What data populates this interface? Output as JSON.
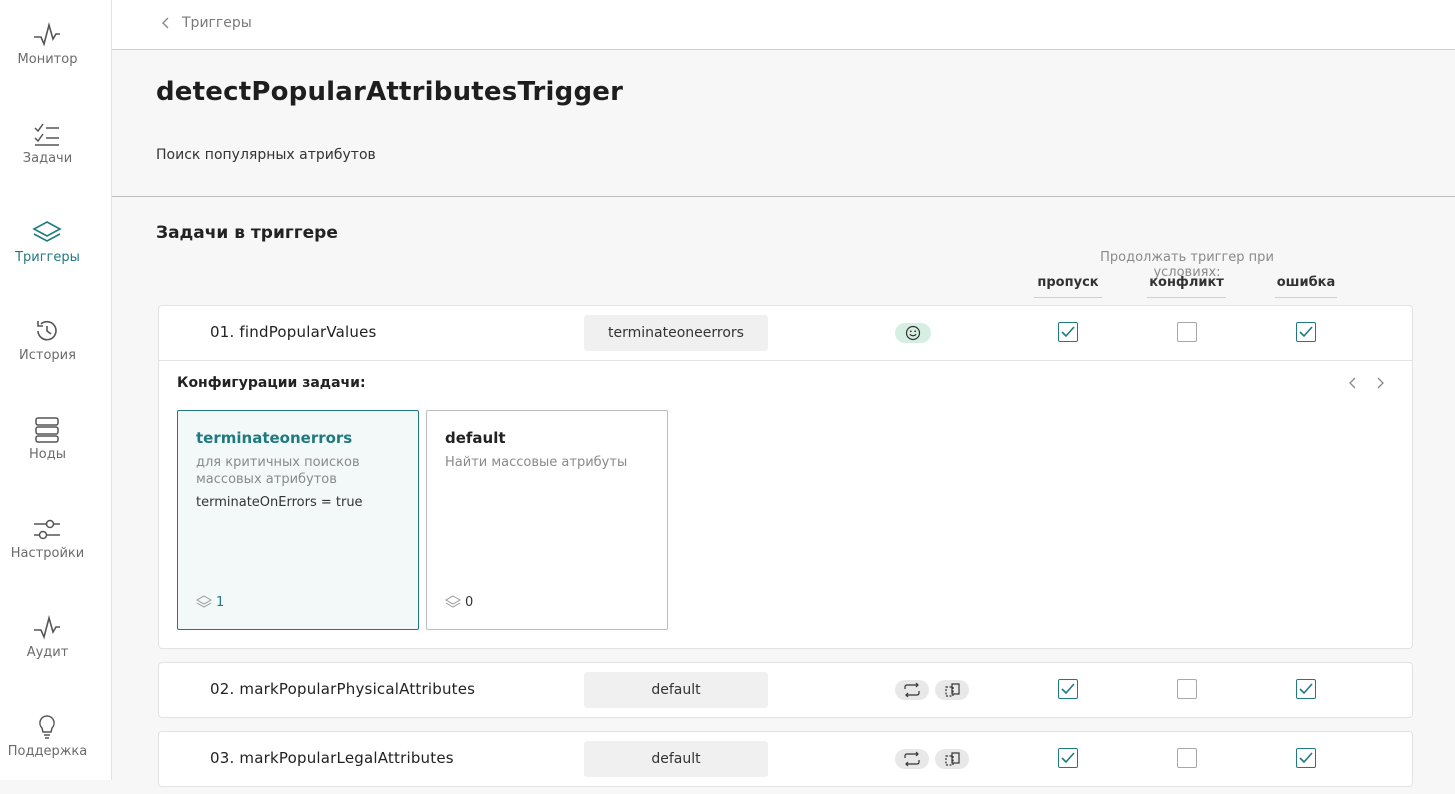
{
  "sidebar": {
    "items": [
      {
        "label": "Монитор",
        "icon": "pulse-icon"
      },
      {
        "label": "Задачи",
        "icon": "checklist-icon"
      },
      {
        "label": "Триггеры",
        "icon": "layers-icon",
        "active": true
      },
      {
        "label": "История",
        "icon": "history-icon"
      },
      {
        "label": "Ноды",
        "icon": "server-icon"
      },
      {
        "label": "Настройки",
        "icon": "sliders-icon"
      },
      {
        "label": "Аудит",
        "icon": "audit-pulse-icon"
      },
      {
        "label": "Поддержка",
        "icon": "lightbulb-icon"
      }
    ]
  },
  "breadcrumb": {
    "back_label": "Триггеры"
  },
  "trigger": {
    "title": "detectPopularAttributesTrigger",
    "description": "Поиск популярных атрибутов"
  },
  "tasks_section": {
    "title": "Задачи в триггере",
    "conditions_title": "Продолжать триггер при условиях:",
    "columns": [
      "пропуск",
      "конфликт",
      "ошибка"
    ]
  },
  "tasks": [
    {
      "name": "01. findPopularValues",
      "config": "terminateoneerrors",
      "status_icons": [
        "smiley-icon"
      ],
      "skip": true,
      "conflict": false,
      "error": true
    },
    {
      "name": "02. markPopularPhysicalAttributes",
      "config": "default",
      "status_icons": [
        "repeat-icon",
        "copy-icon"
      ],
      "skip": true,
      "conflict": false,
      "error": true
    },
    {
      "name": "03. markPopularLegalAttributes",
      "config": "default",
      "status_icons": [
        "repeat-icon",
        "copy-icon"
      ],
      "skip": true,
      "conflict": false,
      "error": true
    }
  ],
  "config_panel": {
    "title": "Конфигурации задачи:",
    "cards": [
      {
        "title": "terminateonerrors",
        "description": "для критичных поисков массовых атрибутов",
        "param": "terminateOnErrors = true",
        "count": "1",
        "selected": true
      },
      {
        "title": "default",
        "description": "Найти массовые атрибуты",
        "param": "",
        "count": "0",
        "selected": false
      }
    ]
  },
  "colors": {
    "accent": "#1f7a80",
    "smiley_bg": "#d7eee3"
  }
}
